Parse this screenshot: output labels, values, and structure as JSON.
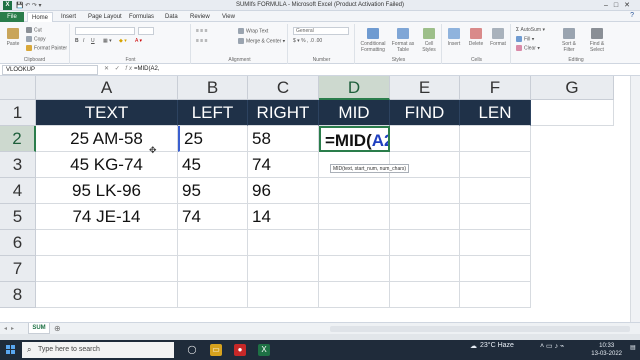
{
  "window": {
    "title": "SUMIfs FORMULA  -  Microsoft Excel (Product Activation Failed)",
    "app_icon": "X"
  },
  "ribbon_tabs": [
    "File",
    "Home",
    "Insert",
    "Page Layout",
    "Formulas",
    "Data",
    "Review",
    "View"
  ],
  "ribbon": {
    "clipboard": {
      "paste": "Paste",
      "cut": "Cut",
      "copy": "Copy",
      "format_painter": "Format Painter",
      "label": "Clipboard"
    },
    "font": {
      "label": "Font",
      "bold": "B",
      "italic": "I",
      "underline": "U"
    },
    "alignment": {
      "wrap_text": "Wrap Text",
      "merge_center": "Merge & Center",
      "label": "Alignment"
    },
    "number": {
      "format": "General",
      "label": "Number"
    },
    "styles": {
      "conditional": "Conditional Formatting",
      "format_table": "Format as Table",
      "cell_styles": "Cell Styles",
      "label": "Styles"
    },
    "cells": {
      "insert": "Insert",
      "delete": "Delete",
      "format": "Format",
      "label": "Cells"
    },
    "editing": {
      "autosum": "AutoSum",
      "fill": "Fill",
      "clear": "Clear",
      "sort_filter": "Sort & Filter",
      "find_select": "Find & Select",
      "label": "Editing"
    }
  },
  "formula_bar": {
    "name_box": "VLOOKUP",
    "formula": "=MID(A2,"
  },
  "columns": [
    "A",
    "B",
    "C",
    "D",
    "E",
    "F",
    "G"
  ],
  "rows": [
    "1",
    "2",
    "3",
    "4",
    "5",
    "6",
    "7",
    "8"
  ],
  "table": {
    "headers": [
      "TEXT",
      "LEFT",
      "RIGHT",
      "MID",
      "FIND",
      "LEN"
    ],
    "rows": [
      {
        "text": "25 AM-58",
        "left": "25",
        "right": "58"
      },
      {
        "text": "45 KG-74",
        "left": "45",
        "right": "74"
      },
      {
        "text": "95 LK-96",
        "left": "95",
        "right": "96"
      },
      {
        "text": "74 JE-14",
        "left": "74",
        "right": "14"
      }
    ],
    "editing_cell": {
      "prefix": "=MID(",
      "ref": "A2",
      "suffix": ","
    }
  },
  "tooltip": "MID(text, start_num, num_chars)",
  "sheet_tab": "SUM",
  "taskbar": {
    "search_placeholder": "Type here to search",
    "weather": "23°C  Haze",
    "time": "10:33",
    "date": "13-03-2022"
  },
  "colors": {
    "header_fill": "#1f3148",
    "excel_green": "#2a7d4b",
    "ref_blue": "#1f3fbf"
  }
}
